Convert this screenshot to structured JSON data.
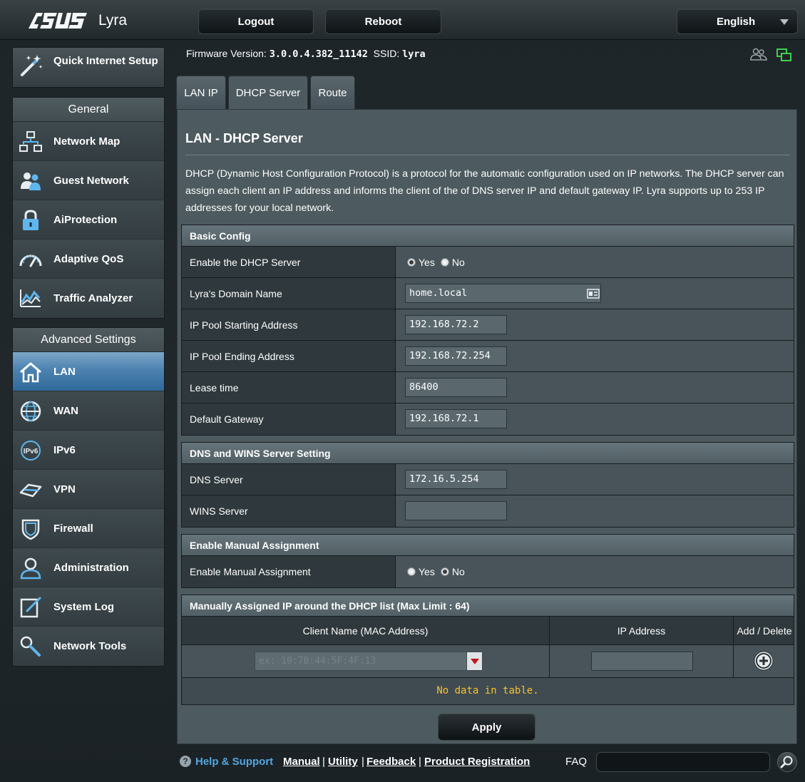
{
  "header": {
    "brand": "ASUS",
    "product": "Lyra",
    "logout": "Logout",
    "reboot": "Reboot",
    "language": "English"
  },
  "info": {
    "firmware_label": "Firmware Version:",
    "firmware_value": "3.0.0.4.382_11142",
    "ssid_label": "SSID:",
    "ssid_value": "lyra"
  },
  "sidebar": {
    "quick_setup": "Quick Internet Setup",
    "general_title": "General",
    "general_items": [
      {
        "label": "Network Map",
        "icon": "network-map-icon"
      },
      {
        "label": "Guest Network",
        "icon": "guest-network-icon"
      },
      {
        "label": "AiProtection",
        "icon": "lock-icon"
      },
      {
        "label": "Adaptive QoS",
        "icon": "gauge-icon"
      },
      {
        "label": "Traffic Analyzer",
        "icon": "traffic-chart-icon"
      }
    ],
    "advanced_title": "Advanced Settings",
    "advanced_items": [
      {
        "label": "LAN",
        "icon": "home-icon",
        "active": true
      },
      {
        "label": "WAN",
        "icon": "globe-icon"
      },
      {
        "label": "IPv6",
        "icon": "ipv6-icon"
      },
      {
        "label": "VPN",
        "icon": "vpn-icon"
      },
      {
        "label": "Firewall",
        "icon": "shield-icon"
      },
      {
        "label": "Administration",
        "icon": "admin-user-icon"
      },
      {
        "label": "System Log",
        "icon": "log-edit-icon"
      },
      {
        "label": "Network Tools",
        "icon": "wrench-icon"
      }
    ]
  },
  "tabs": [
    {
      "label": "LAN IP",
      "active": false
    },
    {
      "label": "DHCP Server",
      "active": true
    },
    {
      "label": "Route",
      "active": false
    }
  ],
  "page": {
    "title": "LAN - DHCP Server",
    "description": "DHCP (Dynamic Host Configuration Protocol) is a protocol for the automatic configuration used on IP networks. The DHCP server can assign each client an IP address and informs the client of the of DNS server IP and default gateway IP. Lyra supports up to 253 IP addresses for your local network."
  },
  "basic_config": {
    "title": "Basic Config",
    "enable_dhcp_label": "Enable the DHCP Server",
    "yes": "Yes",
    "no": "No",
    "enable_dhcp_value": "Yes",
    "domain_label": "Lyra's Domain Name",
    "domain_value": "home.local",
    "pool_start_label": "IP Pool Starting Address",
    "pool_start_value": "192.168.72.2",
    "pool_end_label": "IP Pool Ending Address",
    "pool_end_value": "192.168.72.254",
    "lease_label": "Lease time",
    "lease_value": "86400",
    "gateway_label": "Default Gateway",
    "gateway_value": "192.168.72.1"
  },
  "dns_wins": {
    "title": "DNS and WINS Server Setting",
    "dns_label": "DNS Server",
    "dns_value": "172.16.5.254",
    "wins_label": "WINS Server",
    "wins_value": ""
  },
  "manual_assignment": {
    "title": "Enable Manual Assignment",
    "label": "Enable Manual Assignment",
    "yes": "Yes",
    "no": "No",
    "value": "No"
  },
  "manual_list": {
    "title": "Manually Assigned IP around the DHCP list (Max Limit : 64)",
    "col_client": "Client Name (MAC Address)",
    "col_ip": "IP Address",
    "col_action": "Add / Delete",
    "client_placeholder": "ex: 10:7B:44:5F:4F:13",
    "empty_text": "No data in table."
  },
  "apply": "Apply",
  "footer": {
    "help": "Help & Support",
    "links": [
      "Manual",
      "Utility",
      "Feedback",
      "Product Registration"
    ],
    "faq": "FAQ"
  },
  "colors": {
    "accent_blue": "#53a6e0",
    "empty_text": "#f9c22e",
    "status_green": "#3fd14b"
  }
}
